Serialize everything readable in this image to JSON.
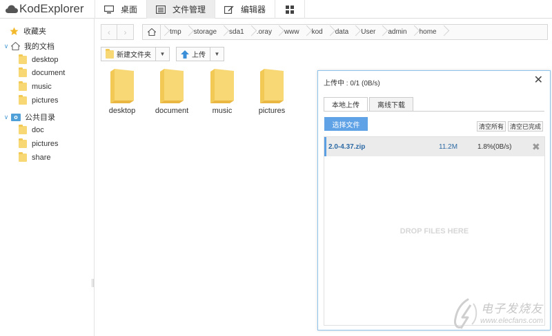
{
  "app": {
    "name": "KodExplorer"
  },
  "nav_tabs": [
    {
      "label": "桌面",
      "icon": "desktop-icon"
    },
    {
      "label": "文件管理",
      "icon": "file-manager-icon"
    },
    {
      "label": "编辑器",
      "icon": "editor-icon"
    },
    {
      "label": "",
      "icon": "grid-icon"
    }
  ],
  "sidebar": {
    "favorites": {
      "label": "收藏夹",
      "icon": "star-icon"
    },
    "my_docs": {
      "label": "我的文档",
      "icon": "home-icon",
      "items": [
        "desktop",
        "document",
        "music",
        "pictures"
      ]
    },
    "public": {
      "label": "公共目录",
      "icon": "public-folder-icon",
      "items": [
        "doc",
        "pictures",
        "share"
      ]
    }
  },
  "breadcrumb": [
    "tmp",
    "storage",
    "sda1",
    ".oray",
    "www",
    "kod",
    "data",
    "User",
    "admin",
    "home"
  ],
  "toolbar": {
    "new_folder": "新建文件夹",
    "upload": "上传"
  },
  "files": [
    "desktop",
    "document",
    "music",
    "pictures"
  ],
  "upload_dialog": {
    "title": "上传中 : 0/1 (0B/s)",
    "tabs": [
      "本地上传",
      "离线下载"
    ],
    "choose_file": "选择文件",
    "clear_all": "清空所有",
    "clear_done": "清空已完成",
    "item": {
      "name": "2.0-4.37.zip",
      "size": "11.2M",
      "progress": "1.8%(0B/s)",
      "progress_fraction": 0.018
    },
    "drop_text": "DROP FILES HERE"
  },
  "watermark": {
    "cn": "电子发烧友",
    "url": "www.elecfans.com"
  },
  "colors": {
    "accent": "#5fa2e6",
    "folder": "#f8d775",
    "link": "#2c6aa5"
  }
}
